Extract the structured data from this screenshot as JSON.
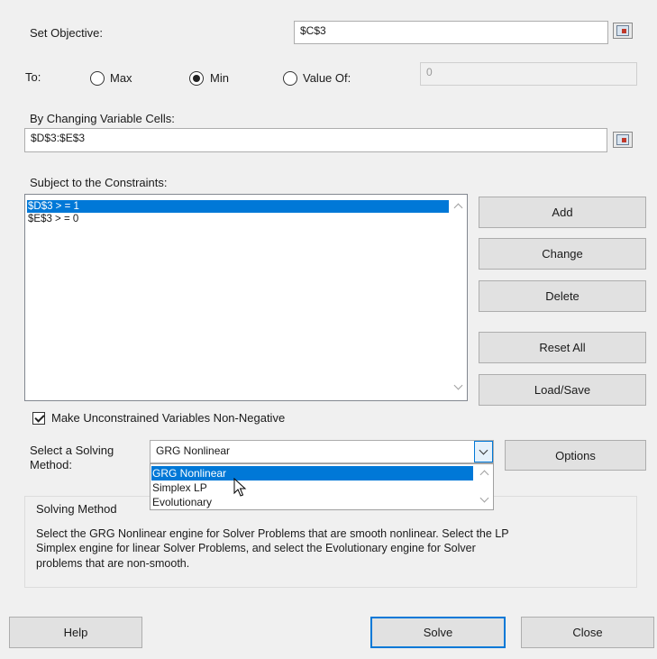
{
  "set_objective": {
    "label": "Set Objective:",
    "value": "$C$3"
  },
  "to": {
    "label": "To:",
    "options": [
      {
        "label": "Max",
        "selected": false
      },
      {
        "label": "Min",
        "selected": true
      },
      {
        "label": "Value Of:",
        "selected": false
      }
    ],
    "value_of": "0"
  },
  "changing_cells": {
    "label": "By Changing Variable Cells:",
    "value": "$D$3:$E$3"
  },
  "constraints": {
    "label": "Subject to the Constraints:",
    "items": [
      "$D$3 > = 1",
      "$E$3 > = 0"
    ]
  },
  "buttons": {
    "add": "Add",
    "change": "Change",
    "delete": "Delete",
    "reset_all": "Reset All",
    "load_save": "Load/Save",
    "options": "Options",
    "help": "Help",
    "solve": "Solve",
    "close": "Close"
  },
  "non_negative": {
    "label": "Make Unconstrained Variables Non-Negative",
    "checked": true
  },
  "solving_method": {
    "label_line1": "Select a Solving",
    "label_line2": "Method:",
    "selected": "GRG Nonlinear",
    "options": [
      "GRG Nonlinear",
      "Simplex LP",
      "Evolutionary"
    ]
  },
  "method_info": {
    "title": "Solving Method",
    "lines": [
      "Select the GRG Nonlinear engine for Solver Problems that are smooth nonlinear. Select the LP",
      "Simplex engine for linear Solver Problems, and select the Evolutionary engine for Solver",
      "problems that are non-smooth."
    ]
  },
  "colors": {
    "selection": "#0078d7",
    "default_button_border": "#0078d7"
  }
}
